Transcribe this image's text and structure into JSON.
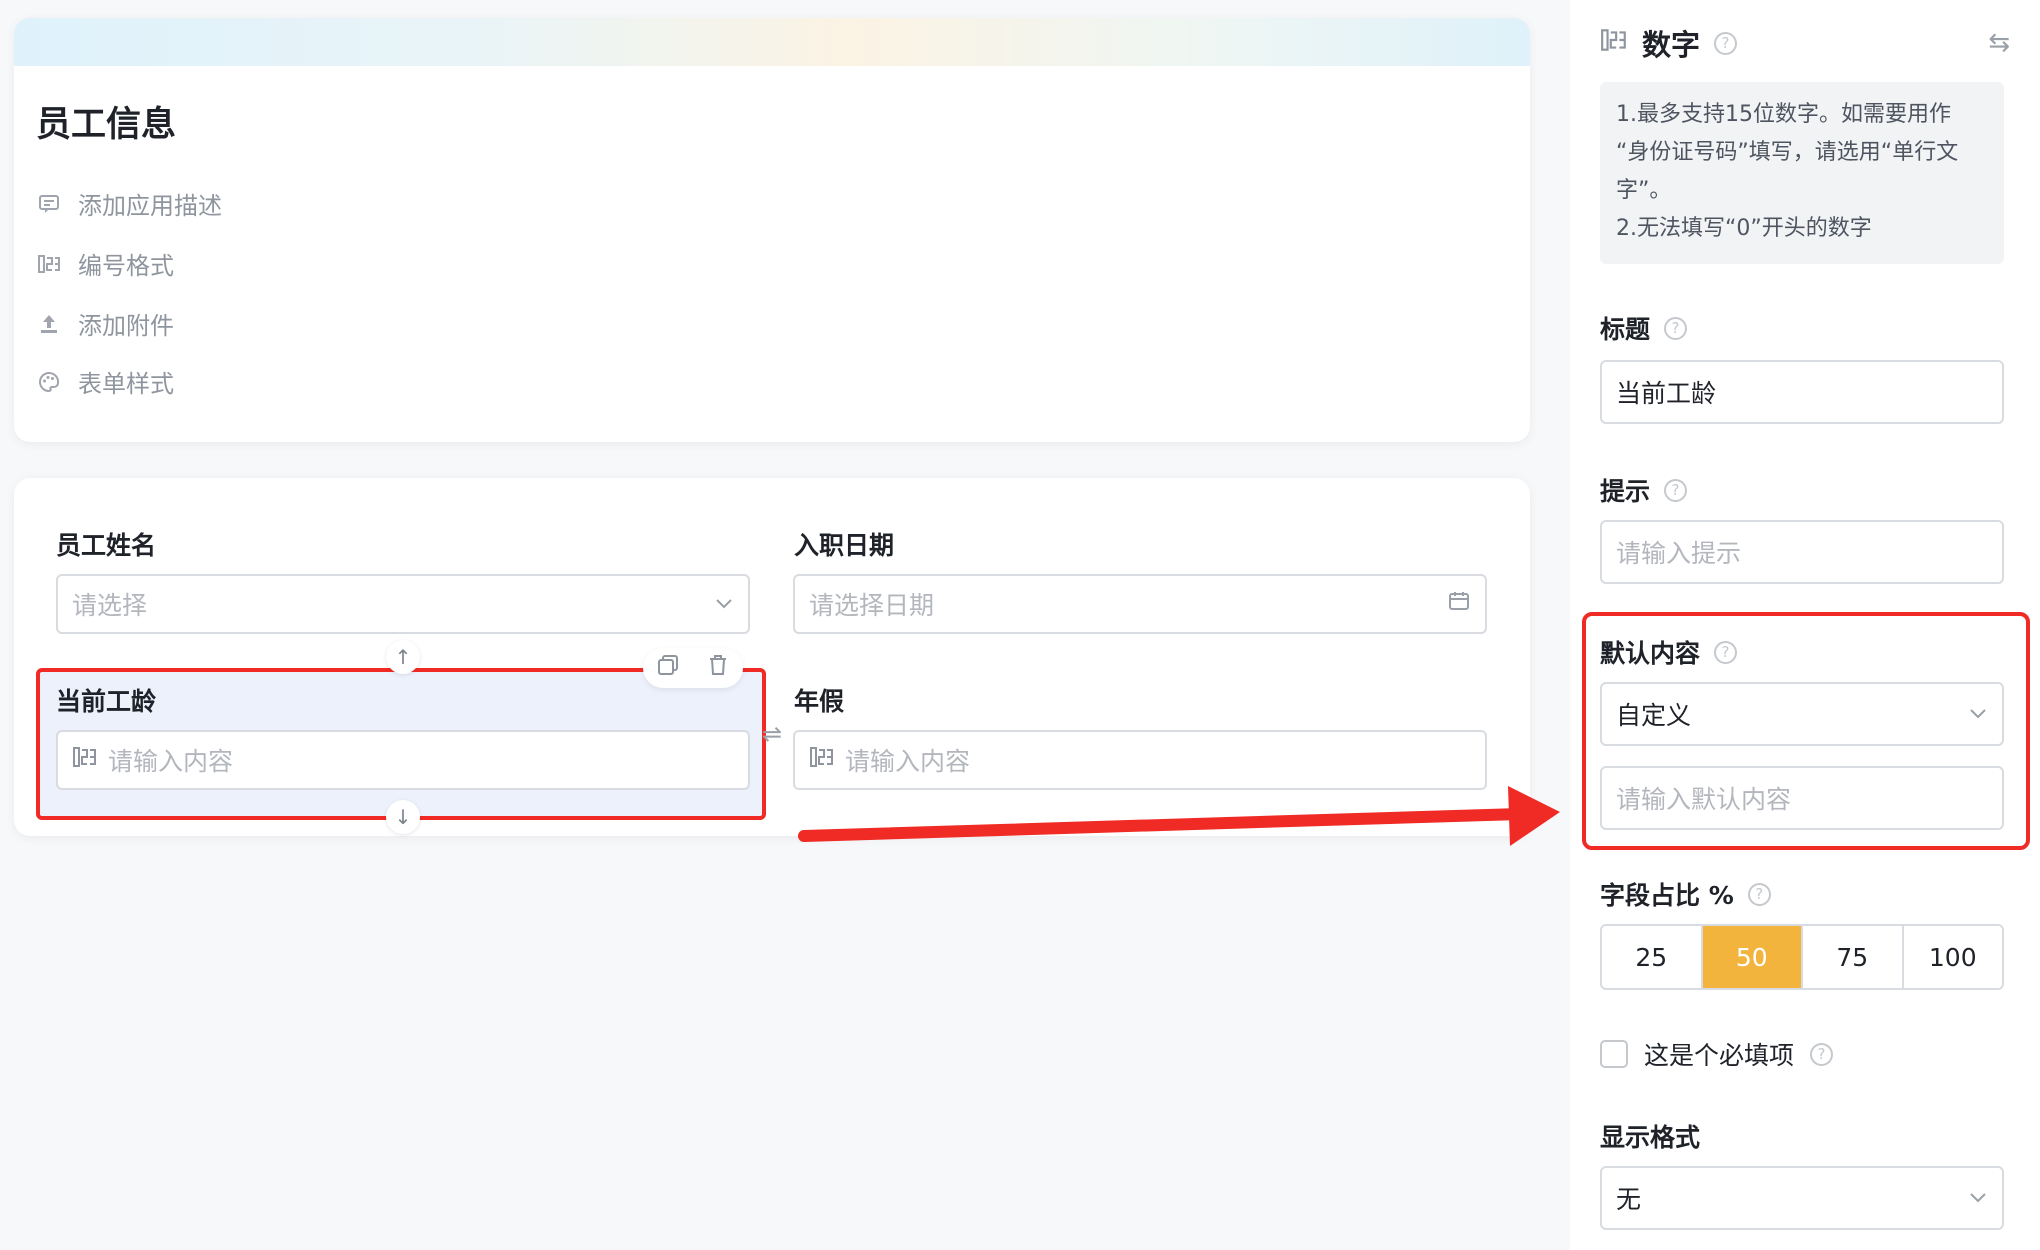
{
  "form_header": {
    "title": "员工信息",
    "options": [
      {
        "label": "添加应用描述",
        "icon": "comment-icon"
      },
      {
        "label": "编号格式",
        "icon": "number-format-icon"
      },
      {
        "label": "添加附件",
        "icon": "upload-icon"
      },
      {
        "label": "表单样式",
        "icon": "palette-icon"
      }
    ]
  },
  "form_fields": {
    "employee_name": {
      "label": "员工姓名",
      "placeholder": "请选择"
    },
    "hire_date": {
      "label": "入职日期",
      "placeholder": "请选择日期"
    },
    "seniority": {
      "label": "当前工龄",
      "placeholder": "请输入内容"
    },
    "annual_leave": {
      "label": "年假",
      "placeholder": "请输入内容"
    }
  },
  "panel": {
    "title": "数字",
    "tip_lines": [
      "1.最多支持15位数字。如需要用作",
      "“身份证号码”填写，请选用“单行文",
      "字”。",
      "2.无法填写“0”开头的数字"
    ],
    "title_field": {
      "label": "标题",
      "value": "当前工龄"
    },
    "hint_field": {
      "label": "提示",
      "placeholder": "请输入提示"
    },
    "default_field": {
      "label": "默认内容",
      "selected": "自定义",
      "placeholder": "请输入默认内容"
    },
    "width_field": {
      "label": "字段占比 %",
      "options": [
        "25",
        "50",
        "75",
        "100"
      ],
      "active": "50"
    },
    "required": {
      "label": "这是个必填项",
      "checked": false
    },
    "display_format": {
      "label": "显示格式",
      "selected": "无"
    }
  },
  "colors": {
    "accent": "#f3b43d",
    "annotation_red": "#f02a24",
    "selected_bg": "#edf1fc"
  }
}
